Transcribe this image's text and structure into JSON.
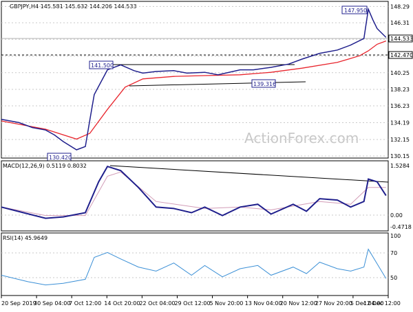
{
  "chart_data": [
    {
      "type": "line",
      "title": "GBPJPY,H4  145.581 145.632 144.206 144.533",
      "x_ticks": [
        "20 Sep 2019",
        "30 Sep 04:00",
        "7 Oct 12:00",
        "14 Oct 20:00",
        "22 Oct 04:00",
        "29 Oct 12:00",
        "5 Nov 20:00",
        "13 Nov 04:00",
        "20 Nov 12:00",
        "27 Nov 20:00",
        "5 Dec 04:00",
        "12 Dec 12:00"
      ],
      "y_ticks": [
        130.15,
        132.15,
        134.19,
        136.23,
        138.23,
        140.25,
        142.27,
        144.3,
        146.31,
        148.29
      ],
      "ylim": [
        129.9,
        148.9
      ],
      "series": [
        {
          "color": "#1f1f8c",
          "x": [
            "20 Sep 2019",
            "24 Sep 2019",
            "27 Sep 2019",
            "30 Sep 2019",
            "2 Oct 2019",
            "4 Oct 2019",
            "7 Oct 2019",
            "9 Oct 2019",
            "10 Oct 2019",
            "11 Oct 2019",
            "14 Oct 2019",
            "17 Oct 2019",
            "20 Oct 2019",
            "22 Oct 2019",
            "25 Oct 2019",
            "29 Oct 2019",
            "1 Nov 2019",
            "5 Nov 2019",
            "8 Nov 2019",
            "13 Nov 2019",
            "16 Nov 2019",
            "20 Nov 2019",
            "24 Nov 2019",
            "27 Nov 2019",
            "1 Dec 2019",
            "5 Dec 2019",
            "8 Dec 2019",
            "11 Dec 2019",
            "12 Dec 2019",
            "13 Dec 2019",
            "14 Dec 2019",
            "16 Dec 2019"
          ],
          "values": [
            134.6,
            134.2,
            133.6,
            133.3,
            132.7,
            131.9,
            130.9,
            131.3,
            134.5,
            137.6,
            140.6,
            141.2,
            140.5,
            140.2,
            140.4,
            140.5,
            140.2,
            140.3,
            140.0,
            140.6,
            140.6,
            140.9,
            141.3,
            141.9,
            142.6,
            143.0,
            143.6,
            144.4,
            147.95,
            146.7,
            145.6,
            144.53
          ]
        },
        {
          "color": "#e8242c",
          "x": [
            "20 Sep 2019",
            "30 Sep 2019",
            "7 Oct 2019",
            "10 Oct 2019",
            "14 Oct 2019",
            "18 Oct 2019",
            "22 Oct 2019",
            "29 Oct 2019",
            "5 Nov 2019",
            "13 Nov 2019",
            "20 Nov 2019",
            "27 Nov 2019",
            "5 Dec 2019",
            "10 Dec 2019",
            "12 Dec 2019",
            "14 Dec 2019",
            "16 Dec 2019"
          ],
          "values": [
            134.4,
            133.4,
            132.2,
            132.9,
            135.8,
            138.5,
            139.5,
            139.8,
            139.9,
            140.0,
            140.3,
            140.8,
            141.5,
            142.3,
            142.9,
            143.7,
            144.1
          ]
        }
      ],
      "annotations": [
        {
          "label": "147.950",
          "x": "12 Dec 2019",
          "y": 147.95
        },
        {
          "label": "141.500",
          "x": "13 Oct 2019",
          "y": 141.5
        },
        {
          "label": "139.316",
          "x": "17 Nov 2019",
          "y": 139.316
        },
        {
          "label": "130.420",
          "x": "4 Oct 2019",
          "y": 130.42
        }
      ],
      "price_labels": [
        {
          "label": "144.533",
          "y": 144.533,
          "kind": "current"
        },
        {
          "label": "142.470",
          "y": 142.47,
          "kind": "level"
        }
      ],
      "watermark": "ActionForex.com"
    },
    {
      "type": "line",
      "title": "MACD(12,26,9) 0.5119 0.8032",
      "y_ticks": [
        "1.5284",
        "0.00",
        "-0.4718"
      ],
      "ylim": [
        -0.75,
        1.75
      ],
      "series": [
        {
          "color": "#1f1f8c",
          "x": [
            "20 Sep 2019",
            "25 Sep 2019",
            "30 Sep 2019",
            "4 Oct 2019",
            "9 Oct 2019",
            "12 Oct 2019",
            "14 Oct 2019",
            "17 Oct 2019",
            "21 Oct 2019",
            "25 Oct 2019",
            "29 Oct 2019",
            "2 Nov 2019",
            "5 Nov 2019",
            "9 Nov 2019",
            "13 Nov 2019",
            "17 Nov 2019",
            "20 Nov 2019",
            "25 Nov 2019",
            "28 Nov 2019",
            "1 Dec 2019",
            "5 Dec 2019",
            "8 Dec 2019",
            "11 Dec 2019",
            "12 Dec 2019",
            "14 Dec 2019",
            "16 Dec 2019"
          ],
          "values": [
            0.1,
            -0.1,
            -0.3,
            -0.25,
            -0.1,
            1.0,
            1.55,
            1.4,
            0.8,
            0.1,
            0.05,
            -0.1,
            0.1,
            -0.2,
            0.1,
            0.2,
            -0.15,
            0.2,
            -0.05,
            0.4,
            0.35,
            0.1,
            0.3,
            1.1,
            1.0,
            0.51
          ]
        },
        {
          "color": "#d19bb6",
          "x": [
            "20 Sep 2019",
            "30 Sep 2019",
            "9 Oct 2019",
            "14 Oct 2019",
            "17 Oct 2019",
            "25 Oct 2019",
            "5 Nov 2019",
            "13 Nov 2019",
            "20 Nov 2019",
            "1 Dec 2019",
            "8 Dec 2019",
            "12 Dec 2019",
            "16 Dec 2019"
          ],
          "values": [
            0.1,
            -0.2,
            -0.2,
            1.2,
            1.35,
            0.3,
            0.05,
            0.1,
            0.0,
            0.3,
            0.2,
            0.8,
            0.8
          ]
        }
      ]
    },
    {
      "type": "line",
      "title": "RSI(14) 45.9649",
      "y_ticks": [
        "100",
        "70",
        "50"
      ],
      "ylim": [
        0,
        100
      ],
      "series": [
        {
          "color": "#3a8fd6",
          "x": [
            "20 Sep 2019",
            "26 Sep 2019",
            "30 Sep 2019",
            "4 Oct 2019",
            "9 Oct 2019",
            "11 Oct 2019",
            "14 Oct 2019",
            "17 Oct 2019",
            "21 Oct 2019",
            "25 Oct 2019",
            "29 Oct 2019",
            "2 Nov 2019",
            "5 Nov 2019",
            "9 Nov 2019",
            "13 Nov 2019",
            "17 Nov 2019",
            "20 Nov 2019",
            "25 Nov 2019",
            "28 Nov 2019",
            "1 Dec 2019",
            "5 Dec 2019",
            "8 Dec 2019",
            "11 Dec 2019",
            "12 Dec 2019",
            "14 Dec 2019",
            "16 Dec 2019"
          ],
          "values": [
            50,
            42,
            38,
            40,
            45,
            72,
            78,
            70,
            60,
            55,
            65,
            50,
            62,
            48,
            58,
            62,
            50,
            60,
            52,
            66,
            58,
            55,
            60,
            82,
            64,
            46
          ]
        }
      ]
    }
  ]
}
